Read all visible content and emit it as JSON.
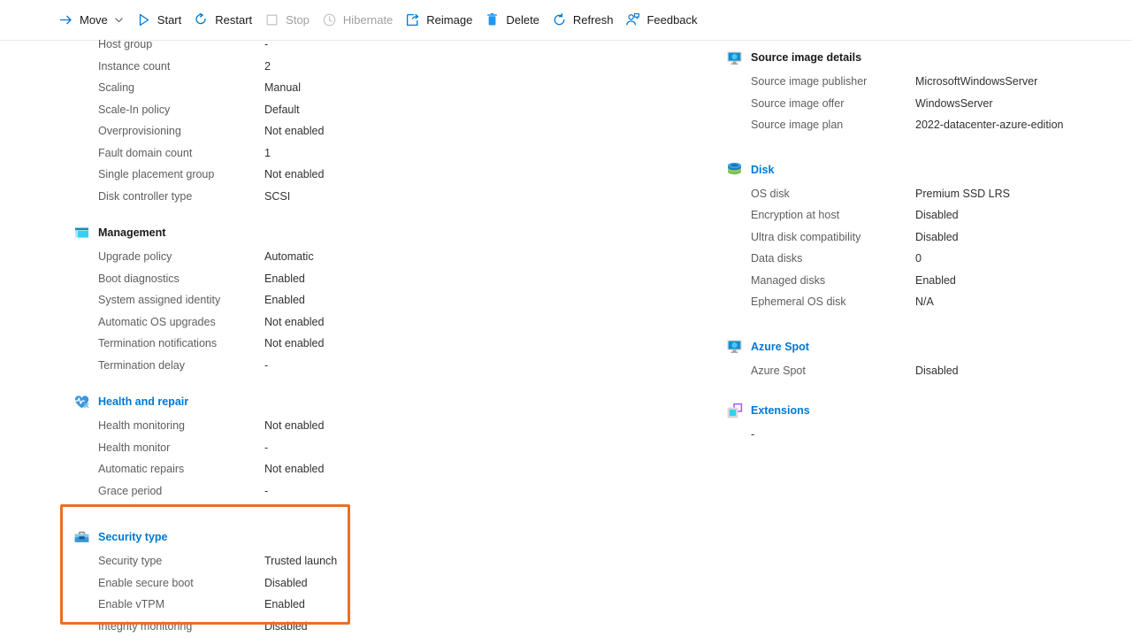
{
  "toolbar": {
    "items": [
      {
        "label": "Move",
        "icon": "arrow-right-icon",
        "disabled": false,
        "chevron": true
      },
      {
        "label": "Start",
        "icon": "play-icon",
        "disabled": false,
        "chevron": false
      },
      {
        "label": "Restart",
        "icon": "restart-icon",
        "disabled": false,
        "chevron": false
      },
      {
        "label": "Stop",
        "icon": "stop-square-icon",
        "disabled": true,
        "chevron": false
      },
      {
        "label": "Hibernate",
        "icon": "clock-icon",
        "disabled": true,
        "chevron": false
      },
      {
        "label": "Reimage",
        "icon": "reimage-icon",
        "disabled": false,
        "chevron": false
      },
      {
        "label": "Delete",
        "icon": "trash-icon",
        "disabled": false,
        "chevron": false
      },
      {
        "label": "Refresh",
        "icon": "refresh-icon",
        "disabled": false,
        "chevron": false
      },
      {
        "label": "Feedback",
        "icon": "feedback-icon",
        "disabled": false,
        "chevron": false
      }
    ]
  },
  "left_column": {
    "top_rows": [
      {
        "label": "Host group",
        "value": "-"
      },
      {
        "label": "Instance count",
        "value": "2"
      },
      {
        "label": "Scaling",
        "value": "Manual"
      },
      {
        "label": "Scale-In policy",
        "value": "Default"
      },
      {
        "label": "Overprovisioning",
        "value": "Not enabled"
      },
      {
        "label": "Fault domain count",
        "value": "1"
      },
      {
        "label": "Single placement group",
        "value": "Not enabled"
      },
      {
        "label": "Disk controller type",
        "value": "SCSI"
      }
    ],
    "management": {
      "title": "Management",
      "icon": "management-monitor-icon",
      "is_link": false,
      "rows": [
        {
          "label": "Upgrade policy",
          "value": "Automatic"
        },
        {
          "label": "Boot diagnostics",
          "value": "Enabled"
        },
        {
          "label": "System assigned identity",
          "value": "Enabled"
        },
        {
          "label": "Automatic OS upgrades",
          "value": "Not enabled"
        },
        {
          "label": "Termination notifications",
          "value": "Not enabled"
        },
        {
          "label": "Termination delay",
          "value": "-"
        }
      ]
    },
    "health_and_repair": {
      "title": "Health and repair",
      "icon": "heart-pulse-icon",
      "is_link": true,
      "rows": [
        {
          "label": "Health monitoring",
          "value": "Not enabled"
        },
        {
          "label": "Health monitor",
          "value": "-"
        },
        {
          "label": "Automatic repairs",
          "value": "Not enabled"
        },
        {
          "label": "Grace period",
          "value": "-"
        }
      ]
    },
    "security_type": {
      "title": "Security type",
      "icon": "toolbox-icon",
      "is_link": true,
      "highlighted": true,
      "highlight_color": "#e6702b",
      "rows": [
        {
          "label": "Security type",
          "value": "Trusted launch"
        },
        {
          "label": "Enable secure boot",
          "value": "Disabled"
        },
        {
          "label": "Enable vTPM",
          "value": "Enabled"
        },
        {
          "label": "Integrity monitoring",
          "value": "Disabled"
        }
      ]
    }
  },
  "right_column": {
    "source_image_details": {
      "title": "Source image details",
      "icon": "monitor-icon",
      "is_link": false,
      "rows": [
        {
          "label": "Source image publisher",
          "value": "MicrosoftWindowsServer"
        },
        {
          "label": "Source image offer",
          "value": "WindowsServer"
        },
        {
          "label": "Source image plan",
          "value": "2022-datacenter-azure-edition"
        }
      ]
    },
    "disk": {
      "title": "Disk",
      "icon": "disk-stack-icon",
      "is_link": true,
      "rows": [
        {
          "label": "OS disk",
          "value": "Premium SSD LRS"
        },
        {
          "label": "Encryption at host",
          "value": "Disabled"
        },
        {
          "label": "Ultra disk compatibility",
          "value": "Disabled"
        },
        {
          "label": "Data disks",
          "value": "0"
        },
        {
          "label": "Managed disks",
          "value": "Enabled"
        },
        {
          "label": "Ephemeral OS disk",
          "value": "N/A"
        }
      ]
    },
    "azure_spot": {
      "title": "Azure Spot",
      "icon": "monitor-icon",
      "is_link": true,
      "rows": [
        {
          "label": "Azure Spot",
          "value": "Disabled"
        }
      ]
    },
    "extensions": {
      "title": "Extensions",
      "icon": "extensions-squares-icon",
      "is_link": true,
      "empty_value": "-"
    }
  },
  "colors": {
    "link": "#0078d4",
    "label": "#605e5c",
    "value": "#323130",
    "highlight": "#e6702b"
  }
}
